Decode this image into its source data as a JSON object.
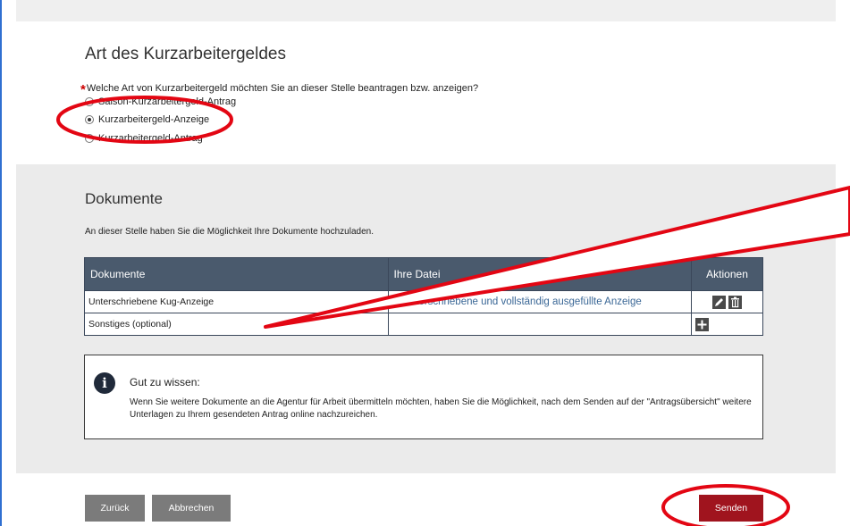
{
  "art": {
    "title": "Art des Kurzarbeitergeldes",
    "question": "Welche Art von Kurzarbeitergeld möchten Sie an dieser Stelle beantragen bzw. anzeigen?",
    "required_marker": "*",
    "options": [
      {
        "label": "Saison-Kurzarbeitergeld-Antrag",
        "checked": false
      },
      {
        "label": "Kurzarbeitergeld-Anzeige",
        "checked": true
      },
      {
        "label": "Kurzarbeitergeld-Antrag",
        "checked": false
      }
    ]
  },
  "documents": {
    "title": "Dokumente",
    "subtitle": "An dieser Stelle haben Sie die Möglichkeit Ihre Dokumente hochzuladen.",
    "columns": [
      "Dokumente",
      "Ihre Datei",
      "Aktionen"
    ],
    "rows": [
      {
        "name": "Unterschriebene Kug-Anzeige",
        "file": "Unterschriebene und vollständig ausgefüllte Anzeige",
        "actions": [
          "edit-icon",
          "trash-icon"
        ]
      },
      {
        "name": "Sonstiges (optional)",
        "file": "",
        "actions": [
          "plus-icon"
        ]
      }
    ]
  },
  "info": {
    "title": "Gut zu wissen:",
    "text": "Wenn Sie weitere Dokumente an die Agentur für Arbeit übermitteln möchten, haben Sie die Möglichkeit, nach dem Senden auf der \"Antragsübersicht\" weitere Unterlagen zu Ihrem gesendeten Antrag online nachzureichen."
  },
  "footer": {
    "back_label": "Zurück",
    "cancel_label": "Abbrechen",
    "send_label": "Senden"
  },
  "colors": {
    "table_header": "#4a5a6d",
    "send_button": "#a0141e",
    "neutral_button": "#7b7b7b",
    "annotation": "#e30613"
  }
}
